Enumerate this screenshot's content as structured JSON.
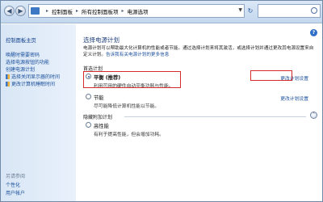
{
  "address_bar": {
    "crumbs": [
      "控制面板",
      "所有控制面板项",
      "电源选项"
    ]
  },
  "sidebar": {
    "home": "控制面板主页",
    "links": [
      "唤醒时需要密码",
      "选择电源按钮的功能",
      "创建电源计划",
      "选择关闭显示器的时间",
      "更改计算机睡眠时间"
    ],
    "see_also": "另请参阅",
    "bottom_links": [
      "个性化",
      "用户帐户"
    ]
  },
  "main": {
    "title": "选择电源计划",
    "description": "电源计划可以帮助最大化计算机的性能或者节能。通过选择计划来将其激活，或选择计划并通过更改其电源设置来自定义计划。",
    "description_link": "告诉我有关电源计划的更多信息",
    "preferred_label": "首选计划",
    "plans": [
      {
        "name": "平衡 (推荐)",
        "desc": "利用可用的硬件自动平衡功耗与性能。",
        "settings": "更改计划设置",
        "selected": true
      },
      {
        "name": "节能",
        "desc": "尽可能降低计算机性能以节能。",
        "settings": "更改计划设置",
        "selected": false
      }
    ],
    "hidden_label": "隐藏附加计划",
    "hidden_plans": [
      {
        "name": "高性能",
        "desc": "有利于提高性能，但会增加功耗。",
        "selected": false
      }
    ]
  },
  "colors": {
    "highlight_box": "#d22c2c",
    "link": "#1a4f9c",
    "title": "#1e3f7a"
  },
  "icons": [
    "back-arrow-icon",
    "forward-arrow-icon",
    "folder-icon",
    "refresh-icon",
    "search-icon",
    "help-icon",
    "shield-icon",
    "collapse-chevron-icon"
  ]
}
